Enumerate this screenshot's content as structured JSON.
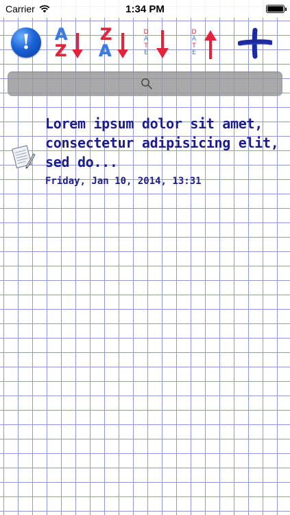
{
  "status_bar": {
    "carrier": "Carrier",
    "time": "1:34 PM"
  },
  "toolbar": {
    "info_symbol": "!",
    "sort_az": {
      "top": "A",
      "bottom": "Z"
    },
    "sort_za": {
      "top": "Z",
      "bottom": "A"
    },
    "date_letters": [
      "D",
      "A",
      "T",
      "E"
    ],
    "add_icon": "plus-icon"
  },
  "search": {
    "placeholder": ""
  },
  "notes": [
    {
      "title": "Lorem ipsum dolor sit amet, consectetur adipisicing elit, sed do...",
      "date": "Friday, Jan 10, 2014, 13:31"
    }
  ],
  "colors": {
    "grid_line": "#8f99d6",
    "note_text": "#1c1c8c",
    "sort_blue": "#3a7be0",
    "sort_red": "#e3233b",
    "add_blue": "#1d2aa0"
  }
}
